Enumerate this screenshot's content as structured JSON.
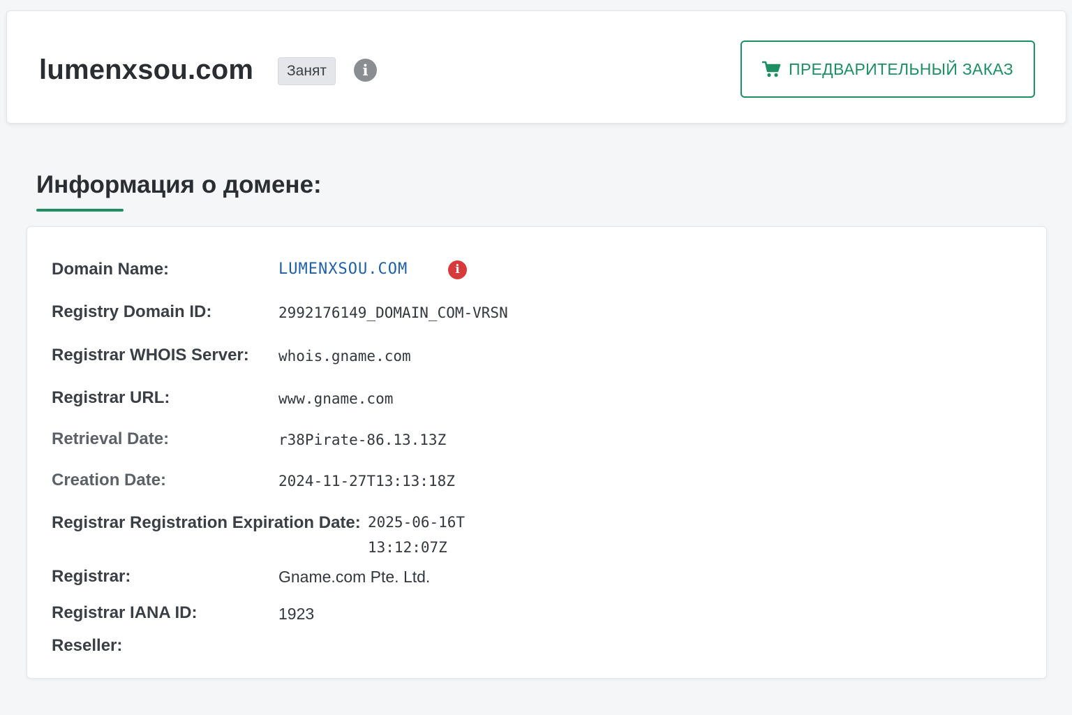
{
  "header": {
    "domain": "lumenxsou.com",
    "status_badge": "Занят",
    "info_icon": "info-circle-icon",
    "preorder_label": "ПРЕДВАРИТЕЛЬНЫЙ ЗАКАЗ",
    "preorder_icon": "shopping-cart-icon",
    "accent_color": "#1e8f63"
  },
  "section": {
    "title": "Информация о домене:"
  },
  "whois": {
    "rows": [
      {
        "label": "Domain Name:",
        "value": "LUMENXSOU.COM"
      },
      {
        "label": "Registry Domain ID:",
        "value": "2992176149_DOMAIN_COM-VRSN"
      },
      {
        "label": "Registrar WHOIS Server:",
        "value": "whois.gname.com"
      },
      {
        "label": "Registrar URL:",
        "value": "www.gname.com"
      },
      {
        "label": "Retrieval Date:",
        "value": "r38Pirate-86.13.13Z"
      },
      {
        "label": "Creation Date:",
        "value": "2024-11-27T13:13:18Z"
      },
      {
        "label": "Registrar Registration Expiration Date:",
        "value": "2025-06-16T13:12:07Z"
      },
      {
        "label": "Registrar:",
        "value": "Gname.com Pte. Ltd."
      },
      {
        "label": "Registrar IANA ID:",
        "value": "1923"
      },
      {
        "label": "Reseller:",
        "value": ""
      }
    ],
    "alert_icon": "info-circle-red-icon",
    "link_color": "#1f5fa6"
  }
}
